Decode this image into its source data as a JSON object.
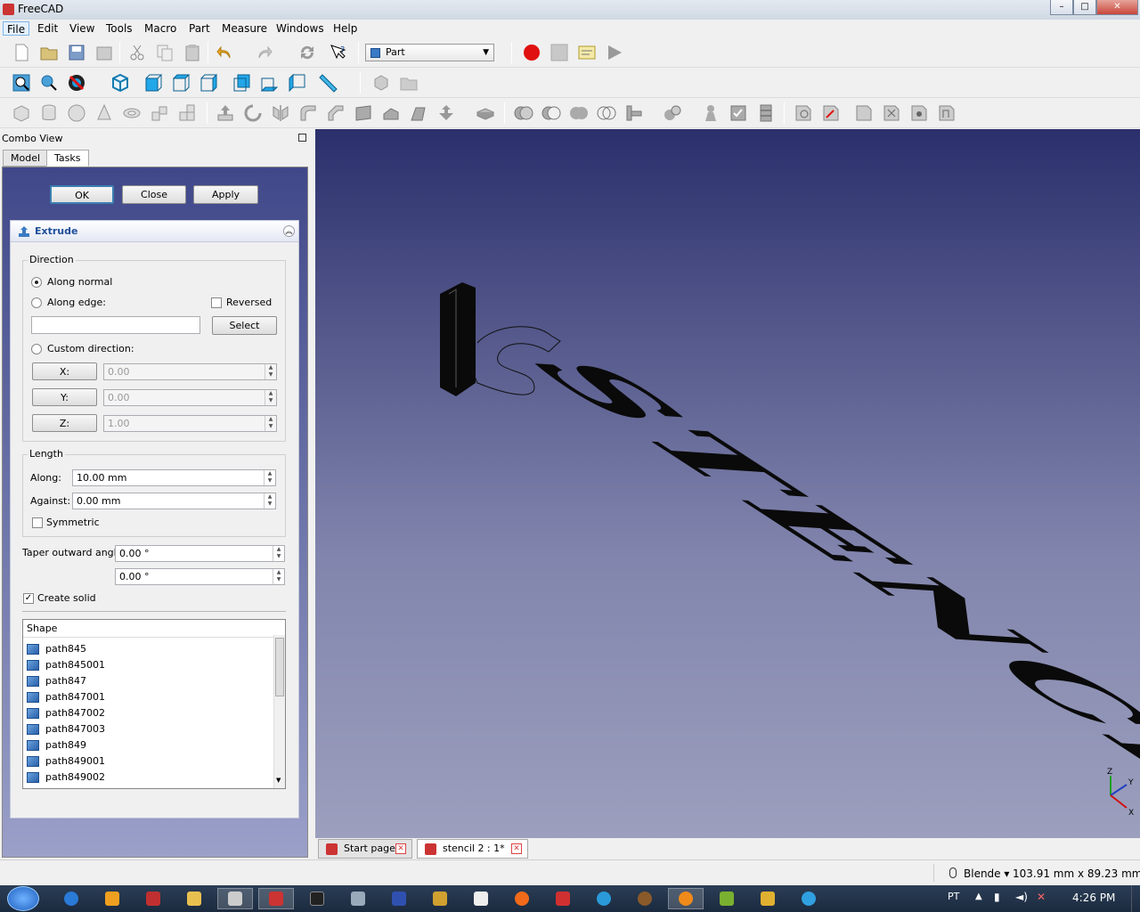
{
  "window": {
    "title": "FreeCAD"
  },
  "menu": [
    "File",
    "Edit",
    "View",
    "Tools",
    "Macro",
    "Part",
    "Measure",
    "Windows",
    "Help"
  ],
  "workbench": {
    "selected": "Part"
  },
  "combo": {
    "title": "Combo View",
    "tabs": [
      "Model",
      "Tasks"
    ],
    "buttons": {
      "ok": "OK",
      "close": "Close",
      "apply": "Apply"
    }
  },
  "extrude": {
    "title": "Extrude",
    "direction": {
      "label": "Direction",
      "along_normal": "Along normal",
      "along_edge": "Along edge:",
      "reversed": "Reversed",
      "select": "Select",
      "custom": "Custom direction:",
      "x_label": "X:",
      "y_label": "Y:",
      "z_label": "Z:",
      "x": "0.00",
      "y": "0.00",
      "z": "1.00"
    },
    "length": {
      "label": "Length",
      "along_label": "Along:",
      "along": "10.00 mm",
      "against_label": "Against:",
      "against": "0.00 mm",
      "symmetric": "Symmetric"
    },
    "taper": {
      "label": "Taper outward angle",
      "value1": "0.00 °",
      "value2": "0.00 °"
    },
    "create_solid": "Create solid",
    "shape_header": "Shape",
    "shapes": [
      "path845",
      "path845001",
      "path847",
      "path847001",
      "path847002",
      "path847003",
      "path849",
      "path849001",
      "path849002"
    ]
  },
  "viewport": {
    "text": "STENCIL",
    "axes": {
      "x": "X",
      "y": "Y",
      "z": "Z"
    }
  },
  "doc_tabs": [
    "Start page",
    "stencil 2 : 1*"
  ],
  "status": {
    "nav": "Blende",
    "dimensions": "103.91 mm x 89.23 mm"
  },
  "taskbar": {
    "lang": "PT",
    "time": "4:26 PM"
  },
  "colors": {
    "accent": "#1f4f9a",
    "record": "#e01010",
    "viewport_top": "#2b2f6c",
    "viewport_bottom": "#9c9fbd"
  }
}
